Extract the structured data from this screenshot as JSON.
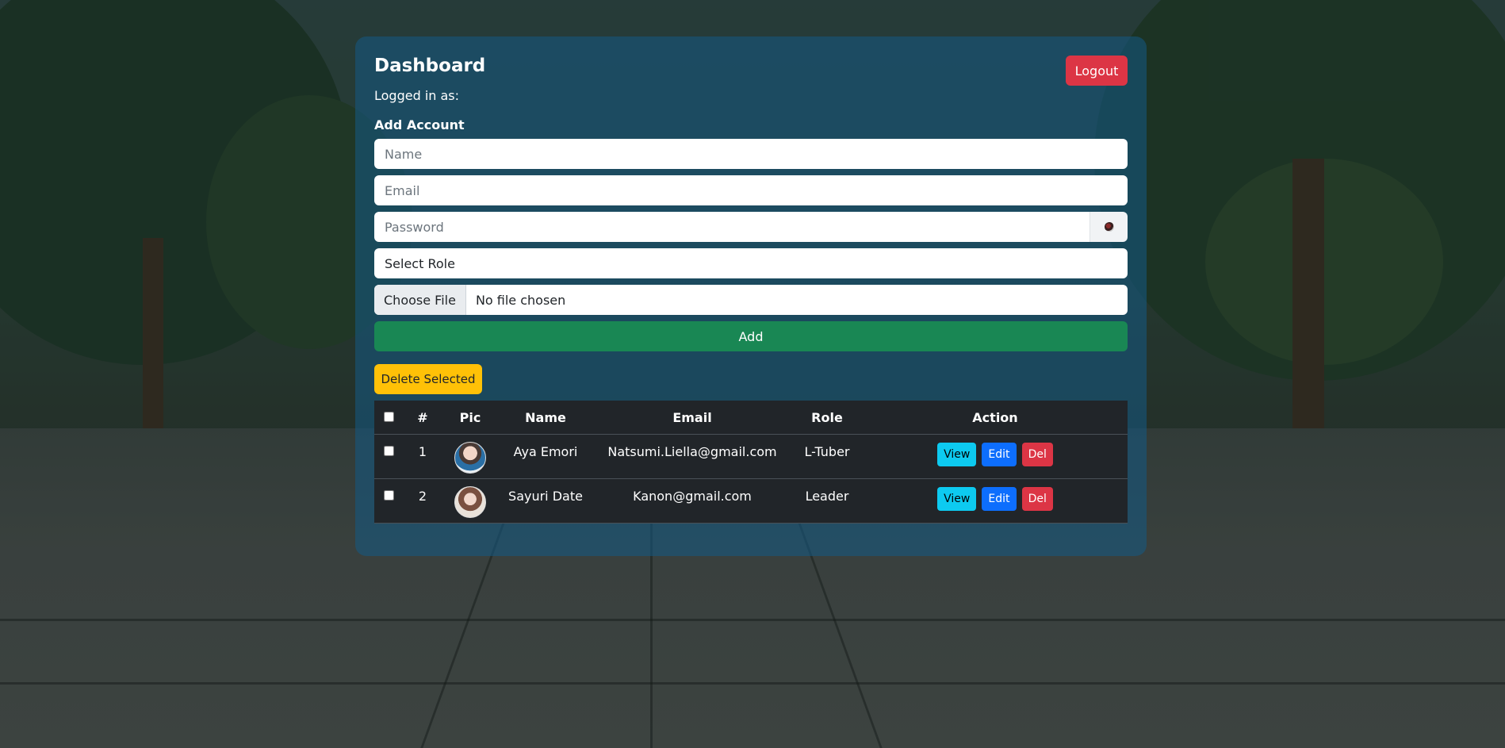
{
  "dashboard": {
    "title": "Dashboard",
    "logged_in_label": "Logged in as:",
    "logout_label": "Logout"
  },
  "form": {
    "heading": "Add Account",
    "name_placeholder": "Name",
    "email_placeholder": "Email",
    "password_placeholder": "Password",
    "password_toggle_icon": "eye-icon",
    "role_select": "Select Role",
    "file_button": "Choose File",
    "file_status": "No file chosen",
    "add_label": "Add"
  },
  "bulk": {
    "delete_selected_label": "Delete Selected"
  },
  "table": {
    "headers": [
      "",
      "#",
      "Pic",
      "Name",
      "Email",
      "Role",
      "Action"
    ],
    "rows": [
      {
        "num": "1",
        "name": "Aya Emori",
        "email": "Natsumi.Liella@gmail.com",
        "role": "L-Tuber"
      },
      {
        "num": "2",
        "name": "Sayuri Date",
        "email": "Kanon@gmail.com",
        "role": "Leader"
      }
    ],
    "actions": {
      "view": "View",
      "edit": "Edit",
      "del": "Del"
    }
  },
  "colors": {
    "danger": "#dc3545",
    "success": "#198754",
    "warning": "#ffc107",
    "info": "#0dcaf0",
    "primary": "#0d6efd",
    "table_bg": "#212529"
  }
}
